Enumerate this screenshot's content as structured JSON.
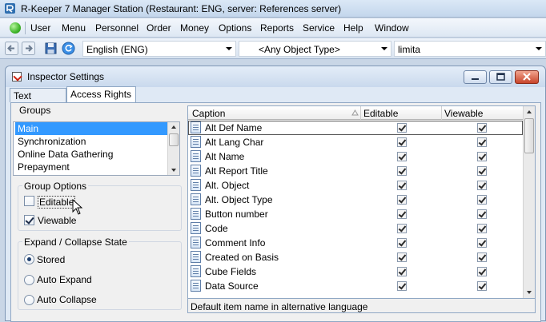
{
  "app": {
    "title": "R-Keeper 7 Manager Station (Restaurant: ENG, server: References server)"
  },
  "menu": {
    "items": [
      {
        "label": "User"
      },
      {
        "label": "Menu"
      },
      {
        "label": "Personnel"
      },
      {
        "label": "Order"
      },
      {
        "label": "Money"
      },
      {
        "label": "Options"
      },
      {
        "label": "Reports"
      },
      {
        "label": "Service"
      },
      {
        "label": "Help"
      },
      {
        "label": "Window"
      }
    ]
  },
  "toolbar": {
    "language_value": "English (ENG)",
    "object_type_value": "<Any Object Type>",
    "filter_value": "limita"
  },
  "inspector": {
    "title": "Inspector Settings",
    "tabs": [
      {
        "label": "Text Options",
        "active": false
      },
      {
        "label": "Access Rights",
        "active": true
      }
    ],
    "groups_label": "Groups",
    "groups": [
      {
        "label": "Main",
        "selected": true
      },
      {
        "label": "Synchronization",
        "selected": false
      },
      {
        "label": "Online Data Gathering",
        "selected": false
      },
      {
        "label": "Prepayment",
        "selected": false
      }
    ],
    "group_options_label": "Group Options",
    "group_options": {
      "editable": {
        "label": "Editable",
        "checked": false
      },
      "viewable": {
        "label": "Viewable",
        "checked": true
      }
    },
    "expand_label": "Expand / Collapse State",
    "expand_options": [
      {
        "label": "Stored",
        "checked": true
      },
      {
        "label": "Auto Expand",
        "checked": false
      },
      {
        "label": "Auto Collapse",
        "checked": false
      }
    ],
    "grid": {
      "columns": {
        "caption": "Caption",
        "editable": "Editable",
        "viewable": "Viewable"
      },
      "rows": [
        {
          "caption": "Alt Def Name",
          "editable": true,
          "viewable": true
        },
        {
          "caption": "Alt Lang Char",
          "editable": true,
          "viewable": true
        },
        {
          "caption": "Alt Name",
          "editable": true,
          "viewable": true
        },
        {
          "caption": "Alt Report Title",
          "editable": true,
          "viewable": true
        },
        {
          "caption": "Alt. Object",
          "editable": true,
          "viewable": true
        },
        {
          "caption": "Alt. Object Type",
          "editable": true,
          "viewable": true
        },
        {
          "caption": "Button number",
          "editable": true,
          "viewable": true
        },
        {
          "caption": "Code",
          "editable": true,
          "viewable": true
        },
        {
          "caption": "Comment Info",
          "editable": true,
          "viewable": true
        },
        {
          "caption": "Created on Basis",
          "editable": true,
          "viewable": true
        },
        {
          "caption": "Cube Fields",
          "editable": true,
          "viewable": true
        },
        {
          "caption": "Data Source",
          "editable": true,
          "viewable": true
        }
      ],
      "status_text": "Default item name in alternative language"
    }
  }
}
